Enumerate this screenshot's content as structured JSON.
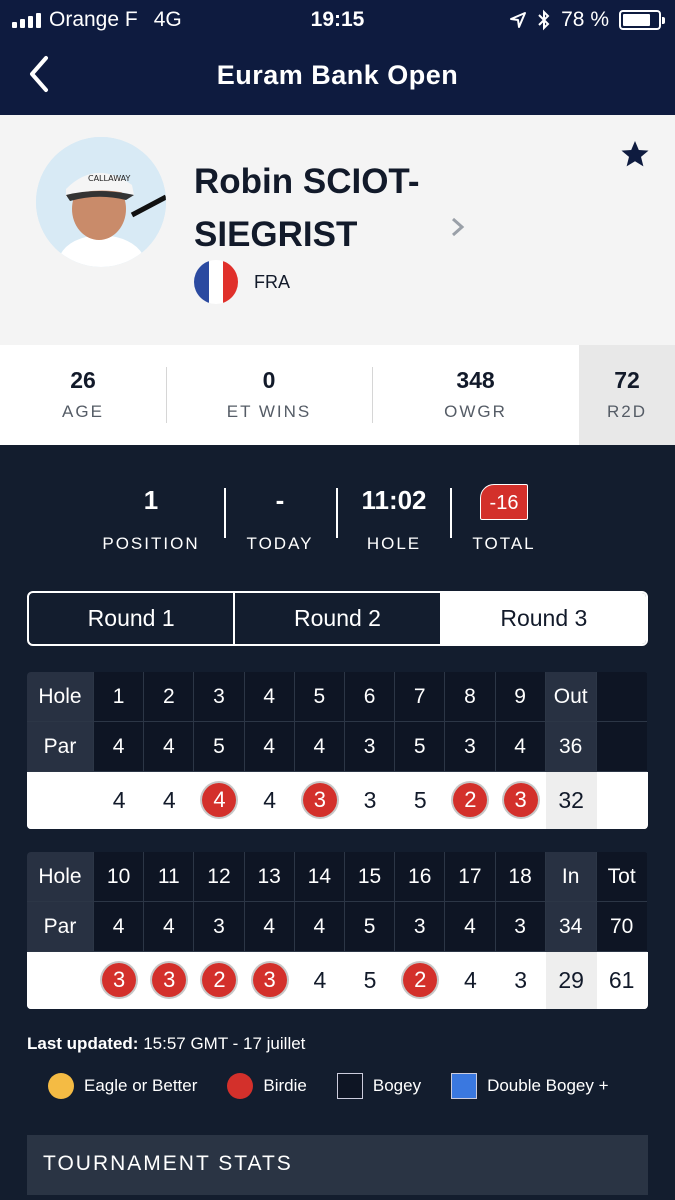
{
  "status_bar": {
    "carrier": "Orange F",
    "network": "4G",
    "time": "19:15",
    "battery": "78 %",
    "battery_level": 0.78
  },
  "header": {
    "title": "Euram Bank Open",
    "back_icon": "chevron-left-icon"
  },
  "player": {
    "name": "Robin SCIOT-SIEGRIST",
    "country_code": "FRA",
    "favorite_icon": "star-icon",
    "details_icon": "chevron-right-icon"
  },
  "player_stats": [
    {
      "value": "26",
      "label": "AGE"
    },
    {
      "value": "0",
      "label": "ET WINS"
    },
    {
      "value": "348",
      "label": "OWGR"
    },
    {
      "value": "72",
      "label": "R2D"
    }
  ],
  "summary": [
    {
      "value": "1",
      "label": "POSITION"
    },
    {
      "value": "-",
      "label": "TODAY"
    },
    {
      "value": "11:02",
      "label": "HOLE"
    },
    {
      "value": "-16",
      "label": "TOTAL"
    }
  ],
  "rounds": {
    "tabs": [
      "Round 1",
      "Round 2",
      "Round 3"
    ],
    "selected": "Round 3"
  },
  "scorecard": {
    "front": {
      "hole_label": "Hole",
      "par_label": "Par",
      "holes": [
        "1",
        "2",
        "3",
        "4",
        "5",
        "6",
        "7",
        "8",
        "9"
      ],
      "sum_label": "Out",
      "par": [
        "4",
        "4",
        "5",
        "4",
        "4",
        "3",
        "5",
        "3",
        "4"
      ],
      "par_total": "36",
      "scores": [
        "4",
        "4",
        "4",
        "4",
        "3",
        "3",
        "5",
        "2",
        "3"
      ],
      "score_total": "32",
      "birdies": [
        false,
        false,
        true,
        false,
        true,
        false,
        false,
        true,
        true
      ]
    },
    "back": {
      "hole_label": "Hole",
      "par_label": "Par",
      "holes": [
        "10",
        "11",
        "12",
        "13",
        "14",
        "15",
        "16",
        "17",
        "18"
      ],
      "sum_label": "In",
      "tot_label": "Tot",
      "par": [
        "4",
        "4",
        "3",
        "4",
        "4",
        "5",
        "3",
        "4",
        "3"
      ],
      "par_total": "34",
      "par_grand": "70",
      "scores": [
        "3",
        "3",
        "2",
        "3",
        "4",
        "5",
        "2",
        "4",
        "3"
      ],
      "score_total": "29",
      "score_grand": "61",
      "birdies": [
        true,
        true,
        true,
        true,
        false,
        false,
        true,
        false,
        false
      ]
    }
  },
  "last_updated": {
    "label": "Last updated:",
    "value": "15:57 GMT - 17 juillet"
  },
  "legend": [
    {
      "label": "Eagle or Better",
      "color": "#f4bb44",
      "shape": "circle"
    },
    {
      "label": "Birdie",
      "color": "#d3302b",
      "shape": "circle"
    },
    {
      "label": "Bogey",
      "color": "#0e1524",
      "shape": "square"
    },
    {
      "label": "Double Bogey +",
      "color": "#3a78e0",
      "shape": "square"
    }
  ],
  "tournament_stats": {
    "label": "TOURNAMENT STATS"
  },
  "colors": {
    "navy": "#0e1b3f",
    "dark": "#131d2e",
    "birdie": "#d3302b"
  }
}
